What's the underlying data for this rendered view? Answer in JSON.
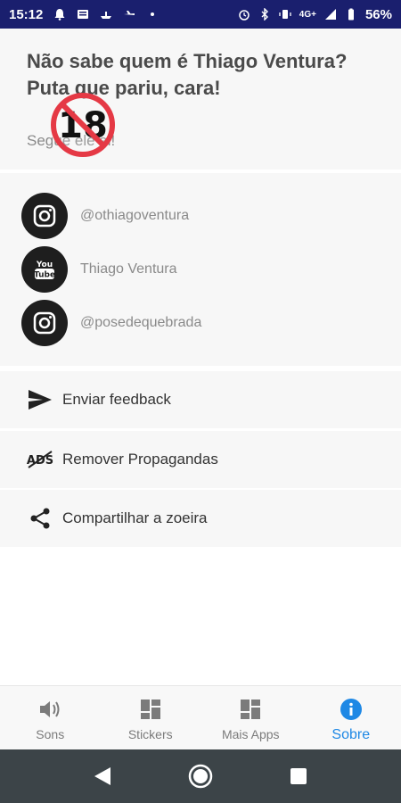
{
  "status_bar": {
    "time": "15:12",
    "network": "4G+",
    "battery": "56%"
  },
  "header": {
    "headline": "Não sabe quem é Thiago Ventura? Puta que pariu, cara!",
    "subline": "Segue ele ai!",
    "age_badge": "18"
  },
  "social": {
    "items": [
      {
        "icon": "instagram-icon",
        "label": "@othiagoventura"
      },
      {
        "icon": "youtube-icon",
        "label": "Thiago Ventura"
      },
      {
        "icon": "instagram-icon",
        "label": "@posedequebrada"
      }
    ]
  },
  "actions": {
    "feedback": "Enviar feedback",
    "remove_ads": "Remover Propagandas",
    "share": "Compartilhar a zoeira"
  },
  "bottom_nav": {
    "items": [
      {
        "label": "Sons",
        "icon": "speaker-icon"
      },
      {
        "label": "Stickers",
        "icon": "grid-icon"
      },
      {
        "label": "Mais Apps",
        "icon": "grid-icon"
      },
      {
        "label": "Sobre",
        "icon": "info-icon"
      }
    ],
    "active": "Sobre",
    "active_color": "#1e88e5"
  }
}
